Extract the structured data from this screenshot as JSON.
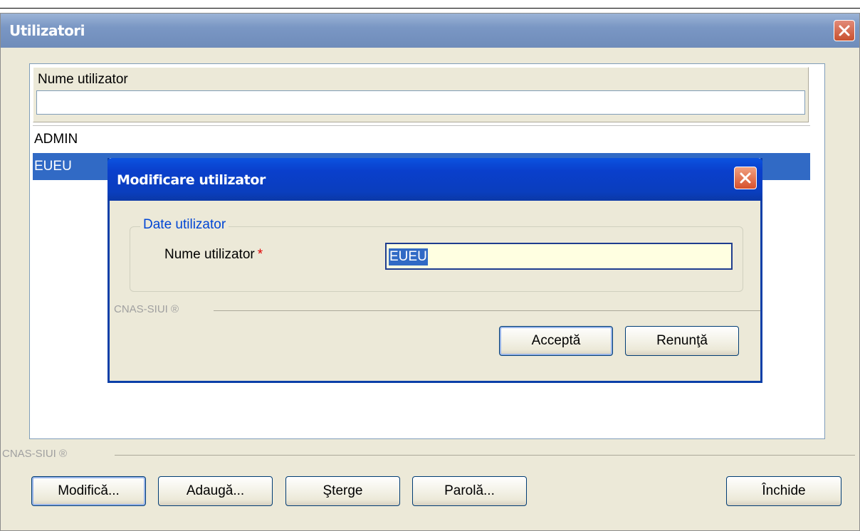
{
  "window": {
    "title": "Utilizatori",
    "list": {
      "column_header": "Nume utilizator",
      "filter_value": "",
      "rows": [
        {
          "name": "ADMIN",
          "selected": false
        },
        {
          "name": "EUEU",
          "selected": true
        }
      ]
    },
    "footer_legend": "CNAS-SIUI ®",
    "buttons": {
      "modify": "Modifică...",
      "add": "Adaugă...",
      "delete": "Şterge",
      "password": "Parolă...",
      "close": "Închide"
    }
  },
  "dialog": {
    "title": "Modificare utilizator",
    "group_title": "Date utilizator",
    "field_label": "Nume utilizator",
    "required_mark": "*",
    "field_value": "EUEU",
    "footer_legend": "CNAS-SIUI ®",
    "buttons": {
      "accept": "Acceptă",
      "cancel": "Renunţă"
    }
  },
  "colors": {
    "selection": "#316ac5",
    "dialog_title": "#0a3fcc",
    "window_title": "#7a97c4",
    "close_red": "#c8512f",
    "input_bg": "#ffffe1"
  }
}
